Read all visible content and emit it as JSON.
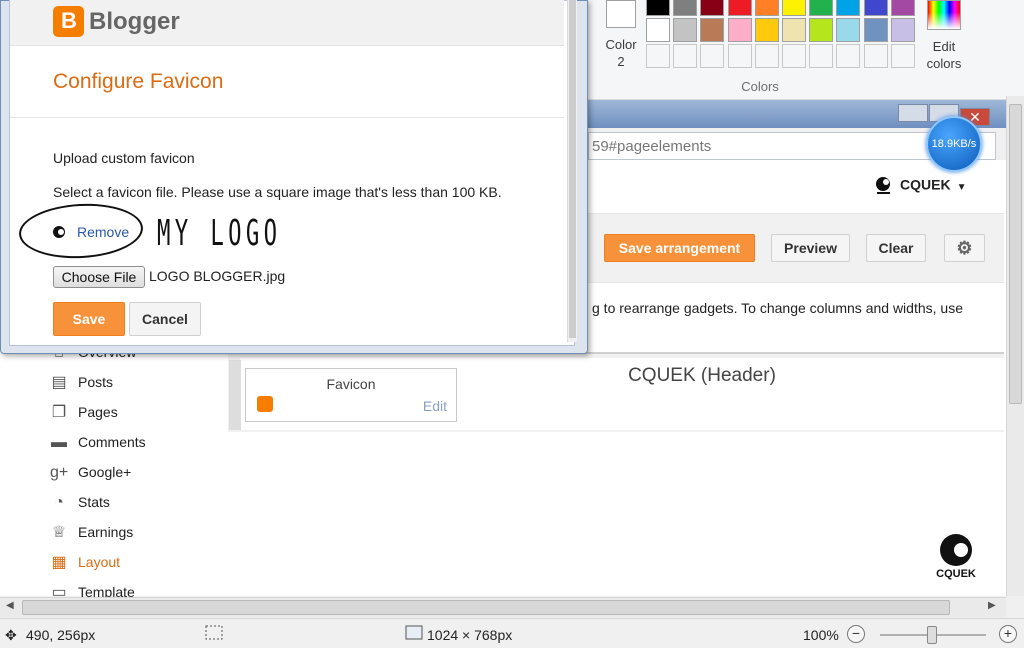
{
  "paint": {
    "color2_label_1": "Color",
    "color2_label_2": "2",
    "colors_group_label": "Colors",
    "edit_colors_label_1": "Edit",
    "edit_colors_label_2": "colors",
    "palette_row1": [
      "#000000",
      "#7f7f7f",
      "#880015",
      "#ed1c24",
      "#ff7f27",
      "#fff200",
      "#22b14c",
      "#00a2e8",
      "#3f48cc",
      "#a349a4"
    ],
    "palette_row2": [
      "#ffffff",
      "#c3c3c3",
      "#b97a57",
      "#ffaec9",
      "#ffc90e",
      "#efe4b0",
      "#b5e61d",
      "#99d9ea",
      "#7092be",
      "#c8bfe7"
    ]
  },
  "browser": {
    "address_text": "59#pageelements",
    "speed_badge": "18.9KB/s",
    "close_glyph": "✕"
  },
  "blogger": {
    "username": "CQUEK",
    "toolbar": {
      "save_arrangement": "Save arrangement",
      "preview": "Preview",
      "clear": "Clear"
    },
    "hint_text": "g to rearrange gadgets. To change columns and widths, use",
    "favicon_gadget_title": "Favicon",
    "favicon_gadget_edit": "Edit",
    "header_label": "CQUEK (Header)",
    "cq_logo_text": "CQUEK",
    "nav": [
      {
        "label": "Overview",
        "icon": "overview-icon"
      },
      {
        "label": "Posts",
        "icon": "posts-icon"
      },
      {
        "label": "Pages",
        "icon": "pages-icon"
      },
      {
        "label": "Comments",
        "icon": "comments-icon"
      },
      {
        "label": "Google+",
        "icon": "google-plus-icon"
      },
      {
        "label": "Stats",
        "icon": "stats-icon"
      },
      {
        "label": "Earnings",
        "icon": "earnings-icon"
      },
      {
        "label": "Layout",
        "icon": "layout-icon",
        "active": true
      },
      {
        "label": "Template",
        "icon": "template-icon"
      }
    ]
  },
  "dialog": {
    "brand": "Blogger",
    "title": "Configure Favicon",
    "upload_label": "Upload custom favicon",
    "select_hint": "Select a favicon file. Please use a square image that's less than 100 KB.",
    "remove_link": "Remove",
    "annotation": "MY LOGO",
    "choose_file": "Choose File",
    "file_name": "LOGO BLOGGER.jpg",
    "save": "Save",
    "cancel": "Cancel"
  },
  "statusbar": {
    "cursor_pos": "490, 256px",
    "image_size": "1024 × 768px",
    "zoom": "100%",
    "zoom_minus": "−",
    "zoom_plus": "+"
  }
}
